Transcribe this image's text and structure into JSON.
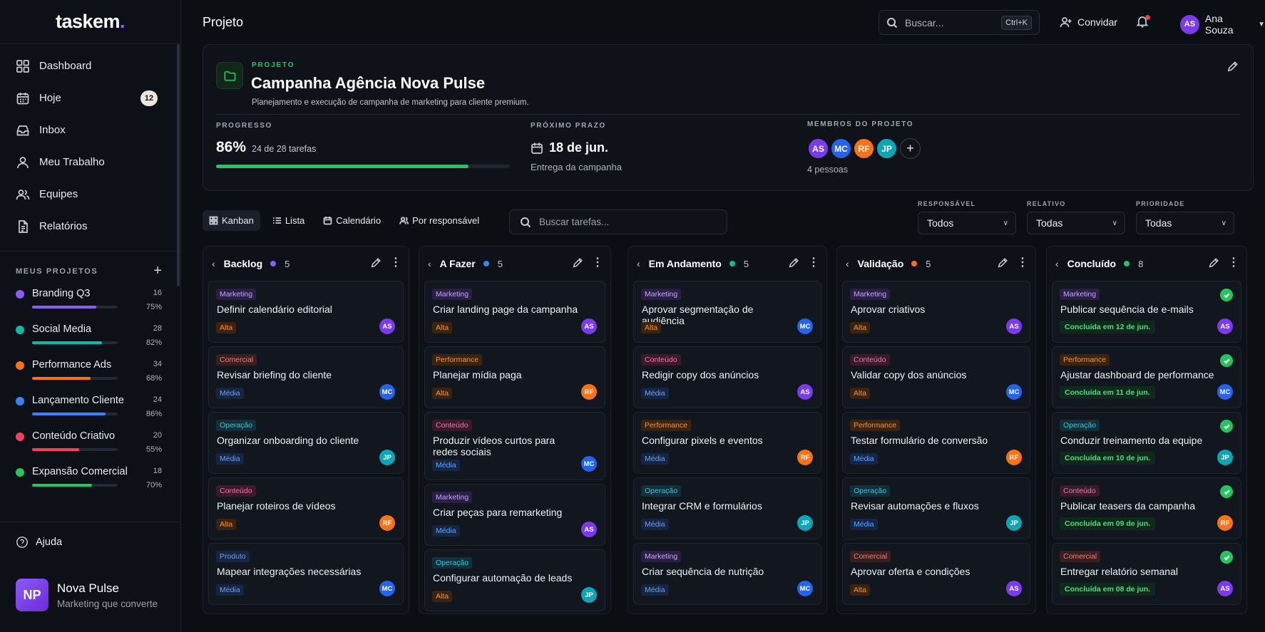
{
  "app": {
    "logo_text": "taskem",
    "logo_dot": "."
  },
  "sidebar": {
    "nav": [
      {
        "label": "Dashboard",
        "icon": "grid-icon"
      },
      {
        "label": "Hoje",
        "icon": "calendar-icon",
        "badge": "12"
      },
      {
        "label": "Inbox",
        "icon": "inbox-icon"
      },
      {
        "label": "Meu Trabalho",
        "icon": "user-icon"
      },
      {
        "label": "Equipes",
        "icon": "users-icon"
      },
      {
        "label": "Relatórios",
        "icon": "report-icon"
      }
    ],
    "section_title": "MEUS PROJETOS",
    "add_label": "+",
    "projects": [
      {
        "name": "Branding Q3",
        "count": "16",
        "pct": "75%",
        "progress": 0.75,
        "color": "#8b5cf6"
      },
      {
        "name": "Social Media",
        "count": "28",
        "pct": "82%",
        "progress": 0.82,
        "color": "#14b8a6"
      },
      {
        "name": "Performance Ads",
        "count": "34",
        "pct": "68%",
        "progress": 0.68,
        "color": "#f97316"
      },
      {
        "name": "Lançamento Cliente",
        "count": "24",
        "pct": "86%",
        "progress": 0.86,
        "color": "#3b82f6"
      },
      {
        "name": "Conteúdo Criativo",
        "count": "20",
        "pct": "55%",
        "progress": 0.55,
        "color": "#f43f5e"
      },
      {
        "name": "Expansão Comercial",
        "count": "18",
        "pct": "70%",
        "progress": 0.7,
        "color": "#22c55e"
      }
    ],
    "help_label": "Ajuda",
    "workspace": {
      "initials": "NP",
      "name": "Nova Pulse",
      "tagline": "Marketing que converte"
    }
  },
  "header": {
    "title": "Projeto",
    "search_placeholder": "Buscar...",
    "search_shortcut": "Ctrl+K",
    "invite_label": "Convidar",
    "user": {
      "initials": "AS",
      "name": "Ana Souza"
    }
  },
  "project": {
    "kicker": "PROJETO",
    "title": "Campanha Agência Nova Pulse",
    "description": "Planejamento e execução de campanha de marketing para cliente premium.",
    "progress_label": "PROGRESSO",
    "progress_pct": "86%",
    "progress_value": 0.86,
    "progress_tasks": "24 de 28 tarefas",
    "deadline_label": "PRÓXIMO PRAZO",
    "deadline_date": "18 de jun.",
    "deadline_sub": "Entrega da campanha",
    "members_label": "MEMBROS DO PROJETO",
    "members": [
      {
        "initials": "AS",
        "color": "#7c3aed"
      },
      {
        "initials": "MC",
        "color": "#2563eb"
      },
      {
        "initials": "RF",
        "color": "#f97316"
      },
      {
        "initials": "JP",
        "color": "#0ea5b7"
      }
    ],
    "members_count": "4 pessoas"
  },
  "toolbar": {
    "views": [
      {
        "label": "Kanban",
        "icon": "kanban-icon",
        "active": true
      },
      {
        "label": "Lista",
        "icon": "list-icon"
      },
      {
        "label": "Calendário",
        "icon": "calendar-icon"
      },
      {
        "label": "Por responsável",
        "icon": "users-icon"
      }
    ],
    "search_placeholder": "Buscar tarefas...",
    "filters": [
      {
        "label": "RESPONSÁVEL",
        "value": "Todos"
      },
      {
        "label": "RELATIVO",
        "value": "Todas"
      },
      {
        "label": "PRIORIDADE",
        "value": "Todas"
      }
    ]
  },
  "avatar_colors": {
    "AS": "#7c3aed",
    "MC": "#2563eb",
    "RF": "#f97316",
    "JP": "#0ea5b7"
  },
  "board": {
    "columns": [
      {
        "name": "Backlog",
        "count": "5",
        "color": "#8b5cf6",
        "cards": [
          {
            "tag": "Marketing",
            "title": "Definir calendário editorial",
            "priority": "Alta",
            "assignee": "AS"
          },
          {
            "tag": "Comercial",
            "title": "Revisar briefing do cliente",
            "priority": "Média",
            "assignee": "MC"
          },
          {
            "tag": "Operação",
            "title": "Organizar onboarding do cliente",
            "priority": "Média",
            "assignee": "JP"
          },
          {
            "tag": "Conteúdo",
            "title": "Planejar roteiros de vídeos",
            "priority": "Alta",
            "assignee": "RF"
          },
          {
            "tag": "Produto",
            "title": "Mapear integrações necessárias",
            "priority": "Média",
            "assignee": "MC"
          }
        ]
      },
      {
        "name": "A Fazer",
        "count": "5",
        "color": "#3b82f6",
        "cards": [
          {
            "tag": "Marketing",
            "title": "Criar landing page da campanha",
            "priority": "Alta",
            "assignee": "AS"
          },
          {
            "tag": "Performance",
            "title": "Planejar mídia paga",
            "priority": "Alta",
            "assignee": "RF"
          },
          {
            "tag": "Conteúdo",
            "title": "Produzir vídeos curtos para redes sociais",
            "priority": "Média",
            "assignee": "MC"
          },
          {
            "tag": "Marketing",
            "title": "Criar peças para remarketing",
            "priority": "Média",
            "assignee": "AS"
          },
          {
            "tag": "Operação",
            "title": "Configurar automação de leads",
            "priority": "Alta",
            "assignee": "JP"
          }
        ]
      },
      {
        "name": "Em Andamento",
        "count": "5",
        "color": "#14b8a6",
        "cards": [
          {
            "tag": "Marketing",
            "title": "Aprovar segmentação de audiência",
            "priority": "Alta",
            "assignee": "MC"
          },
          {
            "tag": "Conteúdo",
            "title": "Redigir copy dos anúncios",
            "priority": "Média",
            "assignee": "AS"
          },
          {
            "tag": "Performance",
            "title": "Configurar pixels e eventos",
            "priority": "Média",
            "assignee": "RF"
          },
          {
            "tag": "Operação",
            "title": "Integrar CRM e formulários",
            "priority": "Média",
            "assignee": "JP"
          },
          {
            "tag": "Marketing",
            "title": "Criar sequência de nutrição",
            "priority": "Média",
            "assignee": "MC"
          }
        ]
      },
      {
        "name": "Validação",
        "count": "5",
        "color": "#f97316",
        "cards": [
          {
            "tag": "Marketing",
            "title": "Aprovar criativos",
            "priority": "Alta",
            "assignee": "AS"
          },
          {
            "tag": "Conteúdo",
            "title": "Validar copy dos anúncios",
            "priority": "Alta",
            "assignee": "MC"
          },
          {
            "tag": "Performance",
            "title": "Testar formulário de conversão",
            "priority": "Média",
            "assignee": "RF"
          },
          {
            "tag": "Operação",
            "title": "Revisar automações e fluxos",
            "priority": "Média",
            "assignee": "JP"
          },
          {
            "tag": "Comercial",
            "title": "Aprovar oferta e condições",
            "priority": "Alta",
            "assignee": "AS"
          }
        ]
      },
      {
        "name": "Concluído",
        "count": "8",
        "color": "#22c55e",
        "cards": [
          {
            "tag": "Marketing",
            "title": "Publicar sequência de e-mails",
            "done": "Concluída em 12 de jun.",
            "assignee": "AS"
          },
          {
            "tag": "Performance",
            "title": "Ajustar dashboard de performance",
            "done": "Concluída em 11 de jun.",
            "assignee": "MC"
          },
          {
            "tag": "Operação",
            "title": "Conduzir treinamento da equipe",
            "done": "Concluída em 10 de jun.",
            "assignee": "JP"
          },
          {
            "tag": "Conteúdo",
            "title": "Publicar teasers da campanha",
            "done": "Concluída em 09 de jun.",
            "assignee": "RF"
          },
          {
            "tag": "Comercial",
            "title": "Entregar relatório semanal",
            "done": "Concluída em 08 de jun.",
            "assignee": "AS"
          }
        ]
      }
    ]
  }
}
